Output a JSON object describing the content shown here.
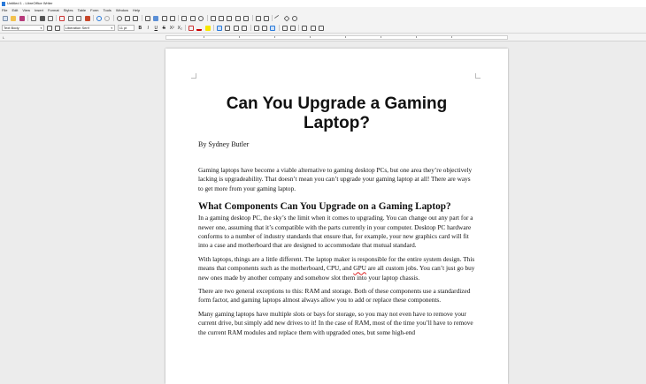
{
  "window": {
    "title": "Untitled 1 - LibreOffice Writer"
  },
  "menu": [
    "File",
    "Edit",
    "View",
    "Insert",
    "Format",
    "Styles",
    "Table",
    "Form",
    "Tools",
    "Window",
    "Help"
  ],
  "toolbar": {
    "paragraph_style": "Text Body",
    "font_name": "Liberation Serif",
    "font_size": "11 pt",
    "bold": "B",
    "italic": "I",
    "underline": "U",
    "strikethrough": "S",
    "superscript": "X²",
    "subscript": "X₂"
  },
  "document": {
    "title": "Can You Upgrade a Gaming Laptop?",
    "byline": "By Sydney Butler",
    "intro": "Gaming laptops have become a viable alternative to gaming desktop PCs, but one area they’re objectively lacking is upgradeability. That doesn’t mean you can’t upgrade your gaming laptop at all! There are ways to get more from your gaming laptop.",
    "heading1": "What Components Can You Upgrade on a Gaming Laptop?",
    "para1": "In a gaming desktop PC, the sky’s the limit when it comes to upgrading. You can change out any part for a newer one, assuming that it’s compatible with the parts currently in your computer. Desktop PC hardware conforms to a number of industry standards that ensure that, for example, your new graphics card will fit into a case and motherboard that are designed to accommodate that mutual standard.",
    "para2_a": "With laptops, things are a little different. The laptop maker is responsible for the entire system design. This means that components such as the motherboard, CPU, and ",
    "para2_gpu": "GPU",
    "para2_b": " are all custom jobs. You can’t just go buy new ones made by another company and somehow slot them into your laptop chassis.",
    "para3": "There are two general exceptions to this: RAM and storage. Both of these components use a standardized form factor, and gaming laptops almost always allow you to add or replace these components.",
    "para4": "Many gaming laptops have multiple slots or bays for storage, so you may not even have to remove your current drive, but simply add new drives to it! In the case of RAM, most of the time you’ll have to remove the current RAM modules and replace them with upgraded ones, but some high-end"
  },
  "colors": {
    "accent": "#2a7ad9",
    "page": "#ffffff",
    "chrome": "#f3f3f3",
    "canvas": "#ececec"
  }
}
